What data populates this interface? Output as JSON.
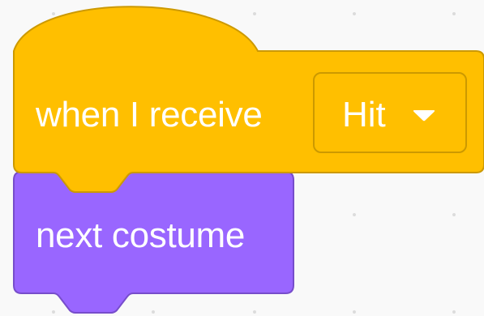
{
  "workspace": {
    "background_color": "#f9f9f9"
  },
  "event_block": {
    "label": "when I receive",
    "color": "#ffbf00",
    "border_color": "#cc9900",
    "dropdown": {
      "selected_value": "Hit",
      "arrow_icon": "triangle-down-icon"
    }
  },
  "looks_block": {
    "label": "next costume",
    "color": "#9966ff",
    "border_color": "#774dcb"
  }
}
